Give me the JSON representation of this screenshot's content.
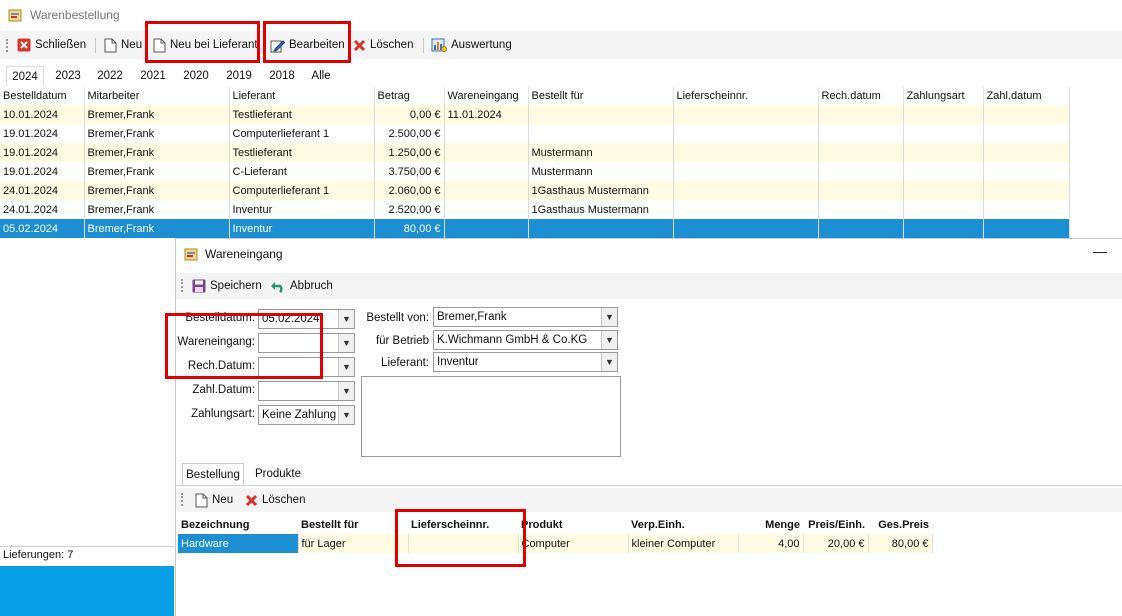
{
  "window": {
    "title": "Warenbestellung"
  },
  "toolbar": {
    "close_label": "Schließen",
    "new_label": "Neu",
    "new_supplier_label": "Neu bei Lieferant",
    "edit_label": "Bearbeiten",
    "delete_label": "Löschen",
    "report_label": "Auswertung"
  },
  "years": [
    "2024",
    "2023",
    "2022",
    "2021",
    "2020",
    "2019",
    "2018",
    "Alle"
  ],
  "grid": {
    "columns": [
      "Bestelldatum",
      "Mitarbeiter",
      "Lieferant",
      "Betrag",
      "Wareneingang",
      "Bestellt für",
      "Lieferscheinnr.",
      "Rech.datum",
      "Zahlungsart",
      "Zahl.datum"
    ],
    "rows": [
      [
        "10.01.2024",
        "Bremer,Frank",
        "Testlieferant",
        "0,00 €",
        "11.01.2024",
        "",
        "",
        "",
        "",
        ""
      ],
      [
        "19.01.2024",
        "Bremer,Frank",
        "Computerlieferant 1",
        "2.500,00 €",
        "",
        "",
        "",
        "",
        "",
        ""
      ],
      [
        "19.01.2024",
        "Bremer,Frank",
        "Testlieferant",
        "1.250,00 €",
        "",
        "Mustermann",
        "",
        "",
        "",
        ""
      ],
      [
        "19.01.2024",
        "Bremer,Frank",
        "C-Lieferant",
        "3.750,00 €",
        "",
        "Mustermann",
        "",
        "",
        "",
        ""
      ],
      [
        "24.01.2024",
        "Bremer,Frank",
        "Computerlieferant 1",
        "2.060,00 €",
        "",
        "1Gasthaus Mustermann",
        "",
        "",
        "",
        ""
      ],
      [
        "24.01.2024",
        "Bremer,Frank",
        "Inventur",
        "2.520,00 €",
        "",
        "1Gasthaus Mustermann",
        "",
        "",
        "",
        ""
      ],
      [
        "05.02.2024",
        "Bremer,Frank",
        "Inventur",
        "80,00 €",
        "",
        "",
        "",
        "",
        "",
        ""
      ]
    ]
  },
  "status": {
    "deliveries": "Lieferungen: 7"
  },
  "dialog": {
    "title": "Wareneingang",
    "minimize": "—",
    "save_label": "Speichern",
    "cancel_label": "Abbruch",
    "labels": {
      "bestelldatum": "Bestelldatum:",
      "wareneingang": "Wareneingang:",
      "rechdatum": "Rech.Datum:",
      "zahldatum": "Zahl.Datum:",
      "zahlungsart": "Zahlungsart:",
      "bestellt_von": "Bestellt von:",
      "fuer_betrieb": "für Betrieb",
      "lieferant": "Lieferant:"
    },
    "values": {
      "bestelldatum": "05.02.2024",
      "wareneingang": "",
      "rechdatum": "",
      "zahldatum": "",
      "zahlungsart": "Keine Zahlung",
      "bestellt_von": "Bremer,Frank",
      "fuer_betrieb": "K.Wichmann GmbH & Co.KG",
      "lieferant": "Inventur"
    },
    "tabs": [
      "Bestellung",
      "Produkte"
    ],
    "sub_new_label": "Neu",
    "sub_delete_label": "Löschen",
    "subgrid": {
      "columns": [
        "Bezeichnung",
        "Bestellt für",
        "Lieferscheinnr.",
        "Produkt",
        "Verp.Einh.",
        "Menge",
        "Preis/Einh.",
        "Ges.Preis"
      ],
      "rows": [
        [
          "Hardware",
          "für Lager",
          "",
          "Computer",
          "kleiner Computer",
          "4,00",
          "20,00 €",
          "80,00 €"
        ]
      ]
    }
  },
  "colors": {
    "selection": "#1b8fd2",
    "row_alt": "#fffbe3",
    "highlight": "#e00000"
  }
}
